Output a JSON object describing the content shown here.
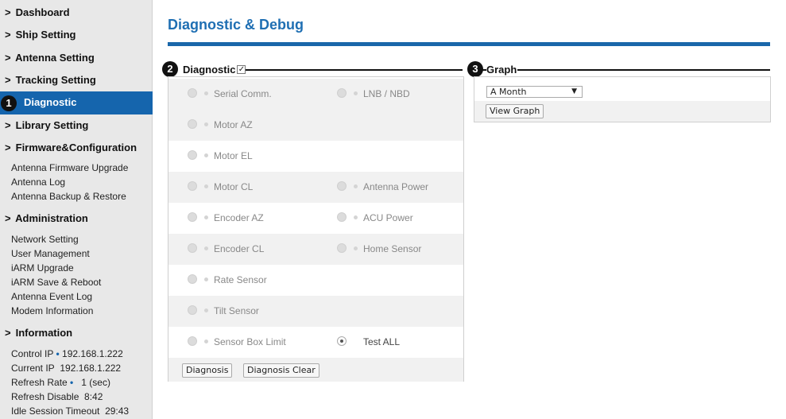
{
  "sidebar": {
    "nav": [
      {
        "label": "Dashboard"
      },
      {
        "label": "Ship Setting"
      },
      {
        "label": "Antenna Setting"
      },
      {
        "label": "Tracking Setting"
      },
      {
        "label": "Diagnostic"
      },
      {
        "label": "Library Setting"
      },
      {
        "label": "Firmware&Configuration"
      },
      {
        "label": "Administration"
      },
      {
        "label": "Information"
      }
    ],
    "firmware_links": [
      "Antenna Firmware Upgrade",
      "Antenna Log",
      "Antenna Backup & Restore"
    ],
    "admin_links": [
      "Network Setting",
      "User Management",
      "iARM Upgrade",
      "iARM Save & Reboot",
      "Antenna Event Log",
      "Modem Information"
    ],
    "info": [
      {
        "label": "Control IP",
        "value": "192.168.1.222",
        "dot": true
      },
      {
        "label": "Current IP",
        "value": "192.168.1.222",
        "dot": false
      },
      {
        "label": "Refresh Rate",
        "value": "1 (sec)",
        "dot": true
      },
      {
        "label": "Refresh Disable",
        "value": "8:42",
        "dot": false
      },
      {
        "label": "Idle Session Timeout",
        "value": "29:43",
        "dot": false
      }
    ],
    "chevron": ">"
  },
  "badges": [
    "1",
    "2",
    "3"
  ],
  "main": {
    "title": "Diagnostic & Debug",
    "diagnostic": {
      "heading": "Diagnostic",
      "checked": true,
      "check_mark": "✓",
      "rows": [
        {
          "left": "Serial Comm.",
          "right": "LNB / NBD"
        },
        {
          "left": "Motor AZ",
          "right": ""
        },
        {
          "left": "Motor EL",
          "right": ""
        },
        {
          "left": "Motor CL",
          "right": "Antenna Power"
        },
        {
          "left": "Encoder AZ",
          "right": "ACU Power"
        },
        {
          "left": "Encoder CL",
          "right": "Home Sensor"
        },
        {
          "left": "Rate Sensor",
          "right": ""
        },
        {
          "left": "Tilt Sensor",
          "right": ""
        },
        {
          "left": "Sensor Box Limit",
          "right": "Test ALL"
        }
      ],
      "selected": "Test ALL",
      "buttons": {
        "diagnosis": "Diagnosis",
        "clear": "Diagnosis Clear"
      }
    },
    "graph": {
      "heading": "Graph",
      "period": "A Month",
      "select_arrow": "▼",
      "view_button": "View Graph"
    }
  },
  "colors": {
    "accent": "#1565ad",
    "title": "#1f6fb3",
    "sidebar_bg": "#e8e8e8"
  }
}
